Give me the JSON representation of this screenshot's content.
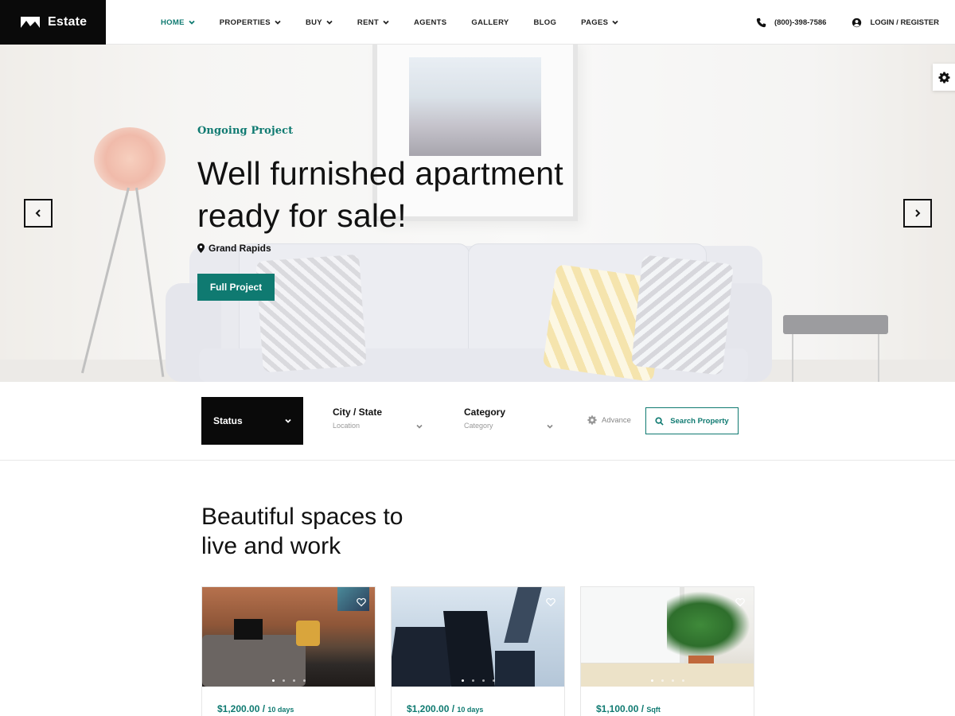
{
  "header": {
    "logo_text": "Estate",
    "nav": [
      {
        "label": "HOME",
        "active": true,
        "dropdown": true
      },
      {
        "label": "PROPERTIES",
        "active": false,
        "dropdown": true
      },
      {
        "label": "BUY",
        "active": false,
        "dropdown": true
      },
      {
        "label": "RENT",
        "active": false,
        "dropdown": true
      },
      {
        "label": "AGENTS",
        "active": false,
        "dropdown": false
      },
      {
        "label": "GALLERY",
        "active": false,
        "dropdown": false
      },
      {
        "label": "BLOG",
        "active": false,
        "dropdown": false
      },
      {
        "label": "PAGES",
        "active": false,
        "dropdown": true
      }
    ],
    "phone": "(800)-398-7586",
    "login": "LOGIN / REGISTER"
  },
  "hero": {
    "eyebrow": "Ongoing Project",
    "title_line1": "Well furnished apartment",
    "title_line2": "ready for sale!",
    "location": "Grand Rapids",
    "button": "Full Project"
  },
  "search": {
    "status_label": "Status",
    "city_label": "City / State",
    "city_placeholder": "Location",
    "category_label": "Category",
    "category_placeholder": "Category",
    "advance_label": "Advance",
    "search_button": "Search Property"
  },
  "section": {
    "title_line1": "Beautiful spaces to",
    "title_line2": "live and work"
  },
  "cards": [
    {
      "price": "$1,200.00",
      "unit": "10 days"
    },
    {
      "price": "$1,200.00",
      "unit": "10 days"
    },
    {
      "price": "$1,100.00",
      "unit": "Sqft"
    }
  ],
  "colors": {
    "accent": "#0f7a71",
    "dark": "#0a0a0a"
  },
  "icons": {
    "phone": "phone-icon",
    "user": "user-circle-icon",
    "gear": "gear-icon",
    "pin": "map-pin-icon",
    "search": "search-icon",
    "heart": "heart-icon",
    "chevron": "chevron-down-icon"
  }
}
